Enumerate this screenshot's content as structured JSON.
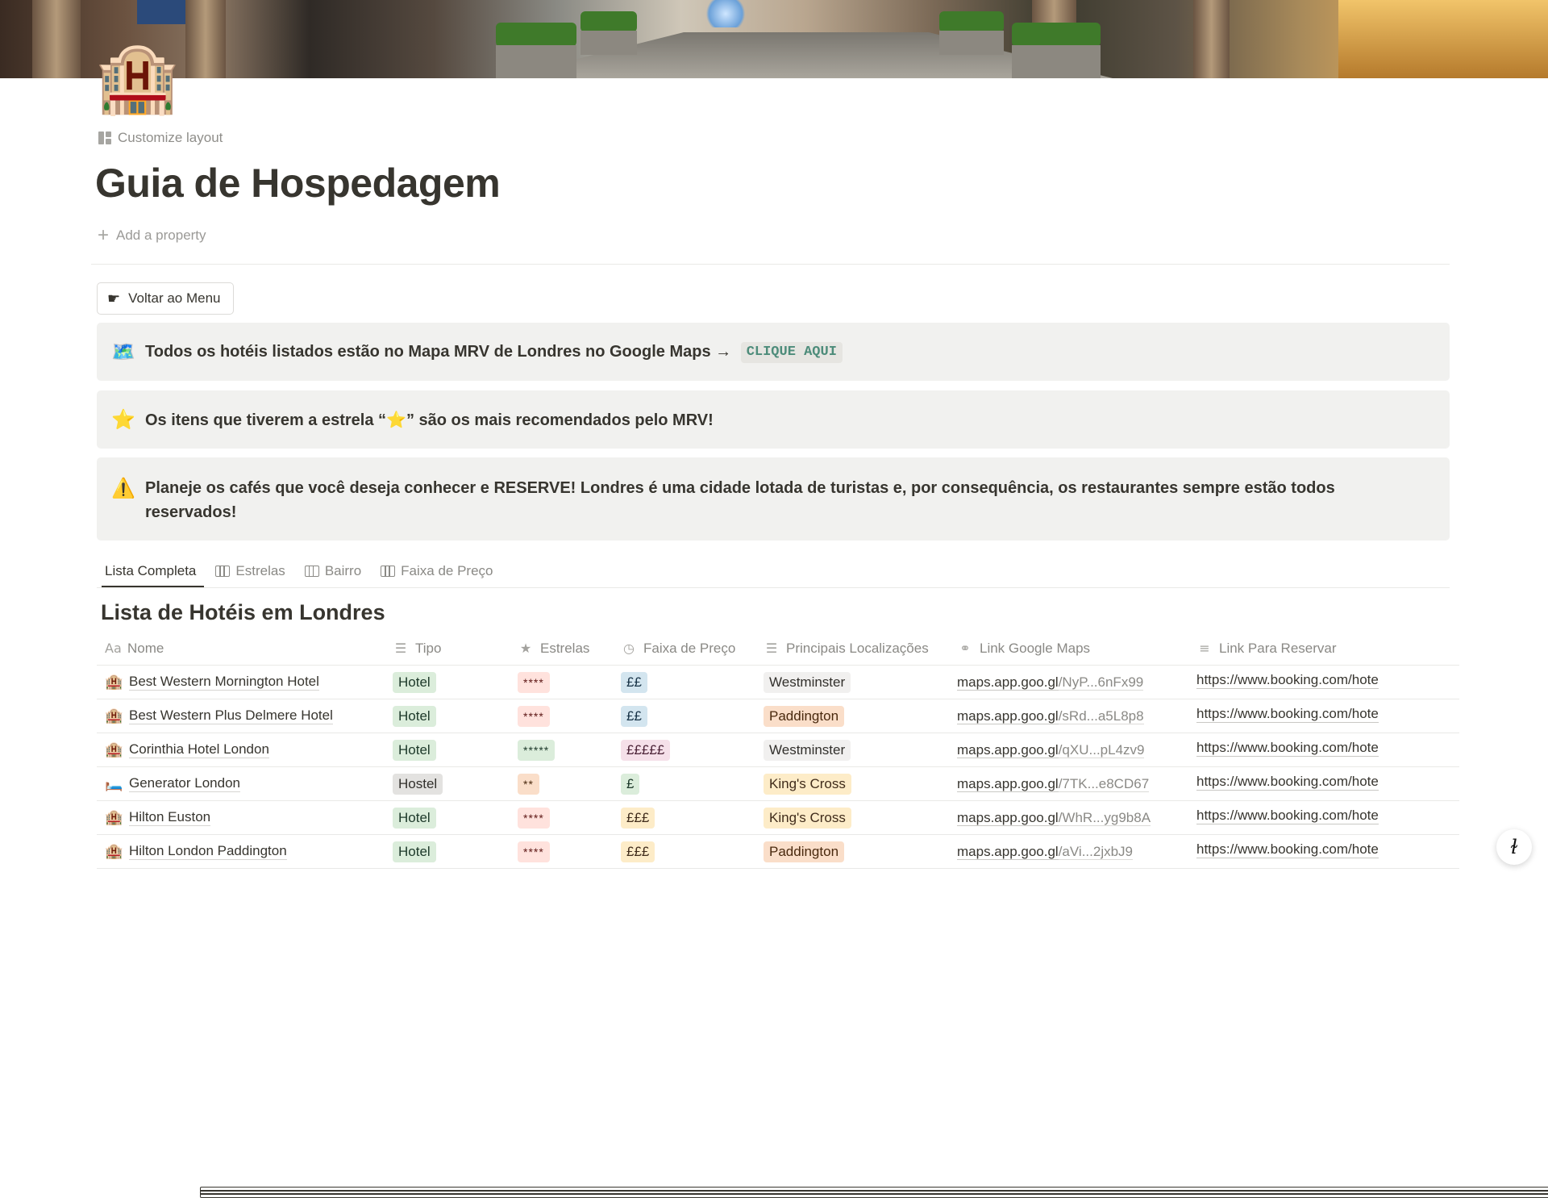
{
  "page": {
    "icon": "🏨",
    "customize_label": "Customize layout",
    "title": "Guia de Hospedagem",
    "add_property_label": "Add a property"
  },
  "back_button": {
    "icon": "pointing-hand-icon",
    "label": "Voltar ao Menu"
  },
  "callouts": [
    {
      "icon": "🗺️",
      "text": "Todos os hotéis listados estão no Mapa MRV de Londres no Google Maps →",
      "chip": "CLIQUE AQUI"
    },
    {
      "icon": "⭐",
      "text_before": "Os itens que tiverem a estrela “",
      "star": "⭐",
      "text_after": "” são os mais recomendados pelo MRV!"
    },
    {
      "icon": "⚠️",
      "text": "Planeje os cafés que você deseja conhecer e RESERVE! Londres é uma cidade lotada de turistas e, por consequência, os restaurantes sempre estão todos reservados!"
    }
  ],
  "tabs": [
    {
      "label": "Lista Completa",
      "icon": "table-icon",
      "active": true
    },
    {
      "label": "Estrelas",
      "icon": "board-icon"
    },
    {
      "label": "Bairro",
      "icon": "board-icon"
    },
    {
      "label": "Faixa de Preço",
      "icon": "board-icon"
    }
  ],
  "database": {
    "title": "Lista de Hotéis em Londres",
    "columns": [
      {
        "label": "Nome",
        "icon": "Aa"
      },
      {
        "label": "Tipo",
        "icon": "list-icon"
      },
      {
        "label": "Estrelas",
        "icon": "star-icon"
      },
      {
        "label": "Faixa de Preço",
        "icon": "clock-icon"
      },
      {
        "label": "Principais Localizações",
        "icon": "list-icon"
      },
      {
        "label": "Link Google Maps",
        "icon": "link-icon"
      },
      {
        "label": "Link Para Reservar",
        "icon": "text-icon"
      }
    ],
    "rows": [
      {
        "emoji": "🏨",
        "name": "Best Western Mornington Hotel",
        "tipo": "Hotel",
        "estrelas": "****",
        "preco": "££",
        "local": "Westminster",
        "gm_domain": "maps.app.goo.gl",
        "gm_path": "/NyP...6nFx99",
        "reserva": "https://www.booking.com/hote"
      },
      {
        "emoji": "🏨",
        "name": "Best Western Plus Delmere Hotel",
        "tipo": "Hotel",
        "estrelas": "****",
        "preco": "££",
        "local": "Paddington",
        "gm_domain": "maps.app.goo.gl",
        "gm_path": "/sRd...a5L8p8",
        "reserva": "https://www.booking.com/hote"
      },
      {
        "emoji": "🏨",
        "name": "Corinthia Hotel London",
        "tipo": "Hotel",
        "estrelas": "*****",
        "preco": "£££££",
        "local": "Westminster",
        "gm_domain": "maps.app.goo.gl",
        "gm_path": "/qXU...pL4zv9",
        "reserva": "https://www.booking.com/hote"
      },
      {
        "emoji": "🛏️",
        "name": "Generator London",
        "tipo": "Hostel",
        "estrelas": "**",
        "preco": "£",
        "local": "King's Cross",
        "gm_domain": "maps.app.goo.gl",
        "gm_path": "/7TK...e8CD67",
        "reserva": "https://www.booking.com/hote"
      },
      {
        "emoji": "🏨",
        "name": "Hilton Euston",
        "tipo": "Hotel",
        "estrelas": "****",
        "preco": "£££",
        "local": "King's Cross",
        "gm_domain": "maps.app.goo.gl",
        "gm_path": "/WhR...yg9b8A",
        "reserva": "https://www.booking.com/hote"
      },
      {
        "emoji": "🏨",
        "name": "Hilton London Paddington",
        "tipo": "Hotel",
        "estrelas": "****",
        "preco": "£££",
        "local": "Paddington",
        "gm_domain": "maps.app.goo.gl",
        "gm_path": "/aVi...2jxbJ9",
        "reserva": "https://www.booking.com/hote"
      }
    ]
  },
  "help_button": {
    "glyph": "?"
  }
}
